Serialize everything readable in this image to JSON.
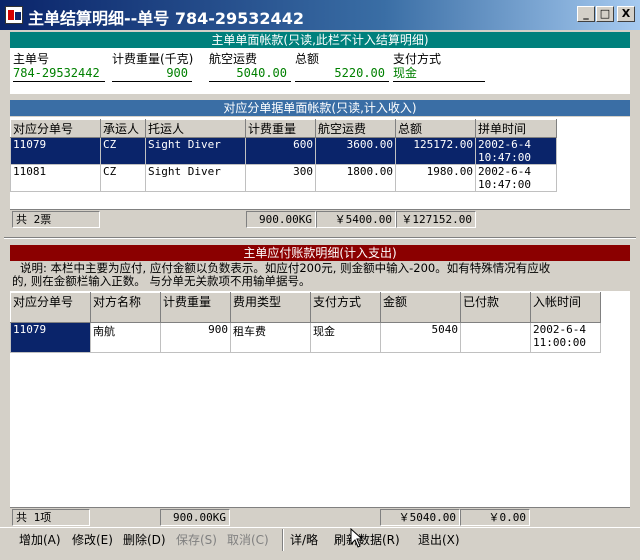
{
  "window": {
    "title": "主单结算明细--单号 784-29532442",
    "minimize": "_",
    "maximize": "□",
    "close": "X"
  },
  "master": {
    "header": "主单单面帐款(只读,此栏不计入结算明细)",
    "fields": [
      {
        "label": "主单号",
        "value": "784-29532442"
      },
      {
        "label": "计费重量(千克)",
        "value": "900"
      },
      {
        "label": "航空运费",
        "value": "5040.00"
      },
      {
        "label": "总额",
        "value": "5220.00"
      },
      {
        "label": "支付方式",
        "value": "现金"
      }
    ]
  },
  "sub": {
    "header": "对应分单据单面帐款(只读,计入收入)",
    "columns": [
      "对应分单号",
      "承运人",
      "托运人",
      "计费重量",
      "航空运费",
      "总额",
      "拼单时间"
    ],
    "rows": [
      {
        "no": "11079",
        "carrier": "CZ",
        "shipper": "Sight Diver",
        "weight": "600",
        "freight": "3600.00",
        "total": "125172.00",
        "date": "2002-6-4",
        "time": "10:47:00"
      },
      {
        "no": "11081",
        "carrier": "CZ",
        "shipper": "Sight Diver",
        "weight": "300",
        "freight": "1800.00",
        "total": "1980.00",
        "date": "2002-6-4",
        "time": "10:47:00"
      }
    ],
    "footer": {
      "count": "共 2票",
      "weight": "900.00KG",
      "freight": "￥5400.00",
      "total": "￥127152.00"
    }
  },
  "payable": {
    "header": "主单应付账款明细(计入支出)",
    "note_line1": "说明: 本栏中主要为应付, 应付金额以负数表示。如应付200元, 则金额中输入-200。如有特殊情况有应收",
    "note_line2": "的, 则在金额栏输入正数。    与分单无关款项不用输单据号。",
    "columns": [
      "对应分单号",
      "对方名称",
      "计费重量",
      "费用类型",
      "支付方式",
      "金额",
      "已付款",
      "入帐时间"
    ],
    "rows": [
      {
        "no": "11079",
        "party": "南航",
        "weight": "900",
        "fee_type": "租车费",
        "pay": "现金",
        "amount": "5040",
        "paid": "",
        "date": "2002-6-4",
        "time": "11:00:00"
      }
    ],
    "footer": {
      "count": "共 1项",
      "weight": "900.00KG",
      "amount": "￥5040.00",
      "paid": "￥0.00"
    }
  },
  "toolbar": {
    "add": "增加(A)",
    "edit": "修改(E)",
    "delete": "删除(D)",
    "save": "保存(S)",
    "cancel": "取消(C)",
    "detail": "详/略",
    "refresh": "刷新数据(R)",
    "exit": "退出(X)"
  }
}
